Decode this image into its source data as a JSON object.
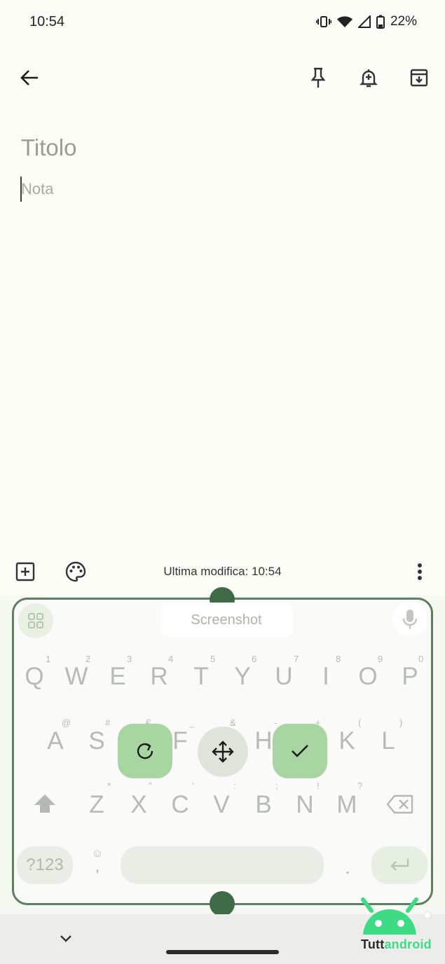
{
  "status": {
    "time": "10:54",
    "battery": "22%"
  },
  "note": {
    "title_placeholder": "Titolo",
    "body_placeholder": "Nota"
  },
  "footer": {
    "edited": "Ultima modifica: 10:54"
  },
  "keyboard": {
    "suggestion": "Screenshot",
    "row1": [
      "Q",
      "W",
      "E",
      "R",
      "T",
      "Y",
      "U",
      "I",
      "O",
      "P"
    ],
    "row1_hints": [
      "1",
      "2",
      "3",
      "4",
      "5",
      "6",
      "7",
      "8",
      "9",
      "0"
    ],
    "row2": [
      "A",
      "S",
      "F",
      "H",
      "K",
      "L"
    ],
    "row2_hints": [
      "@",
      "#",
      "€",
      "_",
      "&",
      "-",
      "+",
      "(",
      ")"
    ],
    "row3": [
      "Z",
      "X",
      "C",
      "V",
      "B",
      "N",
      "M"
    ],
    "row3_hints": [
      "*",
      "\"",
      "'",
      ":",
      ";",
      "!",
      "?"
    ],
    "symbols_label": "?123",
    "comma": ",",
    "period": "."
  },
  "logo": {
    "part1": "Tutt",
    "part2": "android"
  },
  "colors": {
    "accent": "#3e6b45",
    "action_green": "#a8d5a2",
    "logo_green": "#3ddc84"
  }
}
